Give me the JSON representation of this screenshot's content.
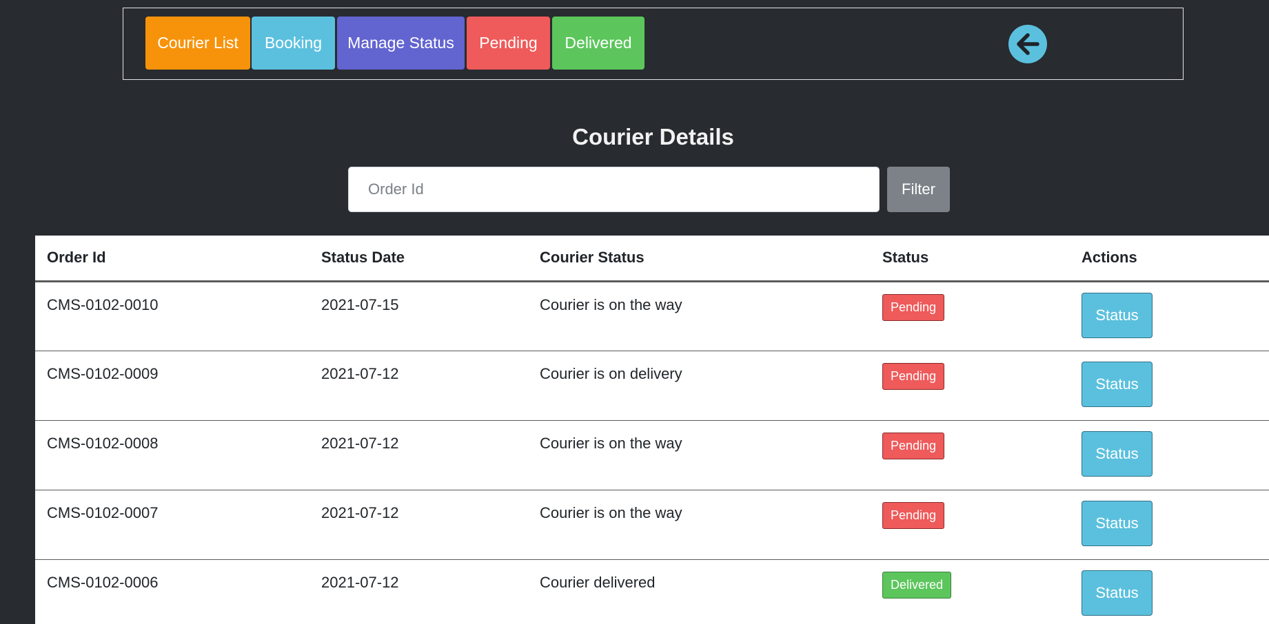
{
  "nav": {
    "items": [
      {
        "label": "Courier List",
        "color": "#f7930b"
      },
      {
        "label": "Booking",
        "color": "#5bc0de"
      },
      {
        "label": "Manage Status",
        "color": "#6264d0"
      },
      {
        "label": "Pending",
        "color": "#ef5a5a"
      },
      {
        "label": "Delivered",
        "color": "#5cc65c"
      }
    ],
    "back_icon": "arrow-left-circle-icon"
  },
  "page": {
    "title": "Courier Details"
  },
  "search": {
    "placeholder": "Order Id",
    "value": "",
    "filter_label": "Filter"
  },
  "table": {
    "columns": [
      "Order Id",
      "Status Date",
      "Courier Status",
      "Status",
      "Actions"
    ],
    "rows": [
      {
        "order_id": "CMS-0102-0010",
        "status_date": "2021-07-15",
        "courier_status": "Courier is on the way",
        "status": "Pending",
        "action": "Status"
      },
      {
        "order_id": "CMS-0102-0009",
        "status_date": "2021-07-12",
        "courier_status": "Courier is on delivery",
        "status": "Pending",
        "action": "Status"
      },
      {
        "order_id": "CMS-0102-0008",
        "status_date": "2021-07-12",
        "courier_status": "Courier is on the way",
        "status": "Pending",
        "action": "Status"
      },
      {
        "order_id": "CMS-0102-0007",
        "status_date": "2021-07-12",
        "courier_status": "Courier is on the way",
        "status": "Pending",
        "action": "Status"
      },
      {
        "order_id": "CMS-0102-0006",
        "status_date": "2021-07-12",
        "courier_status": "Courier delivered",
        "status": "Delivered",
        "action": "Status"
      }
    ]
  },
  "colors": {
    "background": "#282b30",
    "filter": "#7c8288",
    "action": "#5bc0de",
    "pending": "#ef5a5a",
    "delivered": "#5cc65c"
  }
}
